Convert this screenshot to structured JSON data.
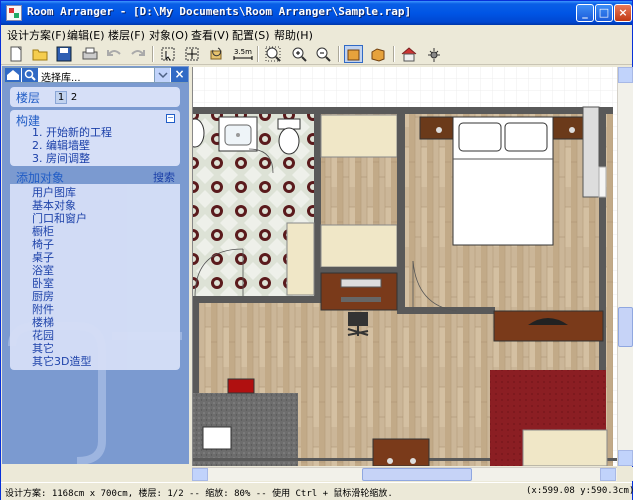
{
  "window": {
    "title": "Room Arranger - [D:\\My Documents\\Room Arranger\\Sample.rap]",
    "buttons": {
      "minimize": "_",
      "maximize": "□",
      "close": "×"
    }
  },
  "menubar": {
    "items": [
      {
        "label": "设计方案(F)"
      },
      {
        "label": "编辑(E)"
      },
      {
        "label": "楼层(F)"
      },
      {
        "label": "对象(O)"
      },
      {
        "label": "查看(V)"
      },
      {
        "label": "配置(S)"
      },
      {
        "label": "帮助(H)"
      }
    ]
  },
  "toolbar": {
    "icons": [
      "new-icon",
      "open-icon",
      "save-icon",
      "print-icon",
      "undo-icon",
      "redo-icon",
      "select-icon",
      "move-icon",
      "rotate-icon",
      "measure-icon",
      "zoom-fit-icon",
      "zoom-in-icon",
      "zoom-out-icon",
      "view-2d-icon",
      "view-3d-icon",
      "house-icon",
      "settings-icon"
    ],
    "measure_label": "3.5m"
  },
  "sidebar": {
    "search": {
      "value": "选择库...",
      "close": "×"
    },
    "floors": {
      "label": "楼层",
      "numbers": [
        "1",
        "2"
      ]
    },
    "build": {
      "label": "构建",
      "collapse": "−",
      "items": [
        "1. 开始新的工程",
        "2. 编辑墙壁",
        "3. 房间调整"
      ]
    },
    "add_objects": {
      "label": "添加对象",
      "search": "搜索",
      "items": [
        "用户图库",
        "基本对象",
        "门口和窗户",
        "橱柜",
        "椅子",
        "桌子",
        "浴室",
        "卧室",
        "厨房",
        "附件",
        "楼梯",
        "花园",
        "其它",
        "其它3D造型"
      ]
    }
  },
  "statusbar": {
    "text": "设计方案: 1168cm x 700cm, 楼层: 1/2 -- 缩放: 80% -- 使用 Ctrl + 鼠标滑轮缩放.",
    "coords": "(x:599.08 y:590.3cm)"
  },
  "colors": {
    "titlebar": "#0055e5",
    "panel": "#7b9ad0",
    "panel_section": "#d6dff7",
    "wall": "#595959",
    "wood_floor": "#c8b496",
    "carpet": "#8b1e23"
  }
}
